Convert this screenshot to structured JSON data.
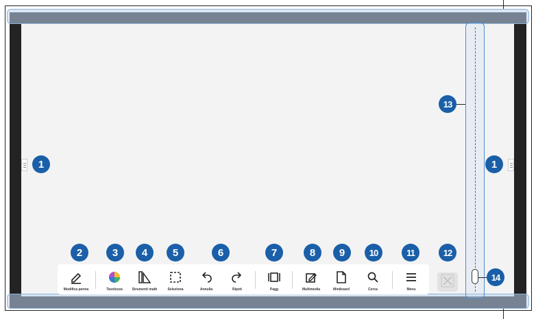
{
  "callouts": {
    "c1a": "1",
    "c1b": "1",
    "c2": "2",
    "c3": "3",
    "c4": "4",
    "c5": "5",
    "c6": "6",
    "c7": "7",
    "c8": "8",
    "c9": "9",
    "c10": "10",
    "c11": "11",
    "c12": "12",
    "c13": "13",
    "c14": "14"
  },
  "toolbar": {
    "pen": "Modifica penna",
    "palette": "Tavolozza",
    "ruler": "Strumenti math",
    "select": "Seleziona",
    "undo": "Annulla",
    "redo": "Ripeti",
    "page": "Pagg",
    "multi": "Multimedia",
    "miniboard": "Miniboard",
    "search": "Cerca",
    "menu": "Menu"
  },
  "icons": {
    "pen": "pen-icon",
    "palette": "color-wheel-icon",
    "ruler": "ruler-icon",
    "select": "selection-icon",
    "undo": "undo-icon",
    "redo": "redo-icon",
    "page": "page-icon",
    "multi": "multimedia-icon",
    "miniboard": "miniboard-icon",
    "search": "search-icon",
    "menu": "menu-icon",
    "close": "close-icon"
  }
}
